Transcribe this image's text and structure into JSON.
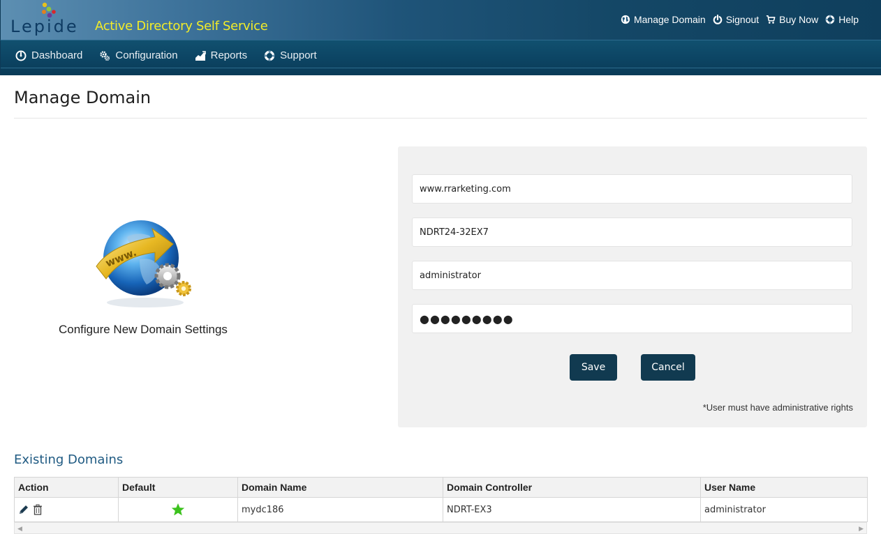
{
  "header": {
    "logo_text": "Lepide",
    "app_title": "Active Directory Self Service",
    "links": [
      {
        "label": "Manage Domain",
        "icon": "globe-icon"
      },
      {
        "label": "Signout",
        "icon": "power-icon"
      },
      {
        "label": "Buy Now",
        "icon": "cart-icon"
      },
      {
        "label": "Help",
        "icon": "lifebuoy-icon"
      }
    ]
  },
  "nav": {
    "items": [
      {
        "label": "Dashboard",
        "icon": "dashboard-icon"
      },
      {
        "label": "Configuration",
        "icon": "gears-icon"
      },
      {
        "label": "Reports",
        "icon": "chart-icon"
      },
      {
        "label": "Support",
        "icon": "lifebuoy-icon"
      }
    ]
  },
  "page": {
    "title": "Manage Domain"
  },
  "illustration": {
    "caption": "Configure New Domain Settings",
    "globe_text": "www."
  },
  "form": {
    "domain_value": "www.rrarketing.com",
    "controller_value": "NDRT24-32EX7",
    "username_value": "administrator",
    "password_value": "●●●●●●●●●",
    "save_label": "Save",
    "cancel_label": "Cancel",
    "note": "*User must have administrative rights"
  },
  "existing": {
    "title": "Existing Domains",
    "columns": [
      "Action",
      "Default",
      "Domain Name",
      "Domain Controller",
      "User Name"
    ],
    "rows": [
      {
        "domain_name": "mydc186",
        "domain_controller": "NDRT-EX3",
        "user_name": "administrator",
        "default": true
      }
    ]
  },
  "colors": {
    "accent": "#113a50",
    "title_yellow": "#f2ec29",
    "section_blue": "#1f5a82",
    "default_star": "#3cc21d"
  }
}
